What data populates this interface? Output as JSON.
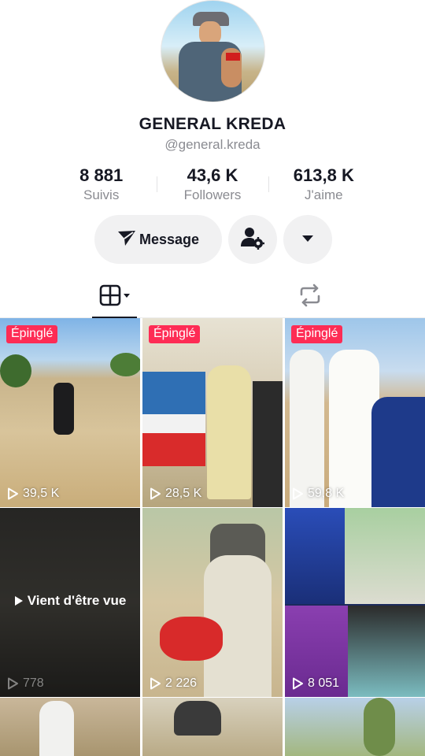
{
  "profile": {
    "name": "GENERAL KREDA",
    "handle": "@general.kreda"
  },
  "stats": [
    {
      "value": "8 881",
      "label": "Suivis"
    },
    {
      "value": "43,6 K",
      "label": "Followers"
    },
    {
      "value": "613,8 K",
      "label": "J'aime"
    }
  ],
  "actions": {
    "message_label": "Message",
    "icons": [
      "send-icon",
      "person-settings-icon",
      "caret-down-icon"
    ]
  },
  "tabs": {
    "icons": [
      "grid-icon",
      "repost-icon"
    ],
    "active": "grid"
  },
  "videos": [
    {
      "badge": "Épinglé",
      "views": "39,5 K"
    },
    {
      "badge": "Épinglé",
      "views": "28,5 K"
    },
    {
      "badge": "Épinglé",
      "views": "59,8 K"
    },
    {
      "overlay": "Vient d'être vue",
      "views": "778"
    },
    {
      "views": "2 226"
    },
    {
      "views": "8 051"
    }
  ],
  "colors": {
    "pin_badge": "#fe2c55",
    "text_primary": "#161823",
    "text_secondary": "#8a8b91",
    "button_bg": "#f1f1f2"
  }
}
